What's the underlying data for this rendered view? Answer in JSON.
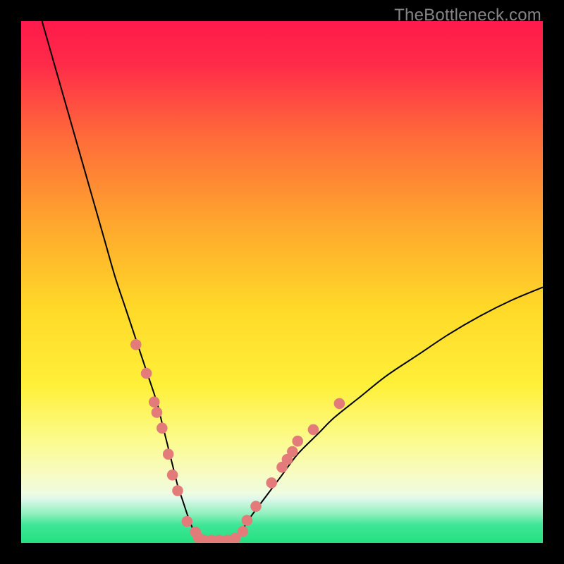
{
  "watermark": "TheBottleneck.com",
  "chart_data": {
    "type": "line",
    "title": "",
    "xlabel": "",
    "ylabel": "",
    "xlim": [
      0,
      100
    ],
    "ylim": [
      0,
      100
    ],
    "gradient_stops": [
      {
        "offset": 0.0,
        "color": "#ff1a4b"
      },
      {
        "offset": 0.08,
        "color": "#ff2a49"
      },
      {
        "offset": 0.22,
        "color": "#ff6a3a"
      },
      {
        "offset": 0.38,
        "color": "#ffa42e"
      },
      {
        "offset": 0.55,
        "color": "#ffd928"
      },
      {
        "offset": 0.7,
        "color": "#fff03a"
      },
      {
        "offset": 0.8,
        "color": "#fcfb8a"
      },
      {
        "offset": 0.87,
        "color": "#f7fbc4"
      },
      {
        "offset": 0.905,
        "color": "#eefce0"
      },
      {
        "offset": 0.915,
        "color": "#dff8ea"
      },
      {
        "offset": 0.945,
        "color": "#8ef0bb"
      },
      {
        "offset": 0.965,
        "color": "#3fe697"
      },
      {
        "offset": 1.0,
        "color": "#25e081"
      }
    ],
    "series": [
      {
        "name": "bottleneck-curve",
        "color": "#000000",
        "x": [
          4,
          6,
          8,
          10,
          12,
          14,
          16,
          18,
          20,
          22,
          24,
          26,
          27,
          28,
          29,
          30,
          31,
          32,
          33,
          34,
          35,
          36.5,
          38,
          40,
          42,
          44,
          47,
          50,
          53,
          57,
          60,
          65,
          70,
          76,
          82,
          88,
          94,
          100
        ],
        "y": [
          100,
          93,
          86,
          79,
          72,
          65,
          58,
          51,
          45,
          39,
          33,
          27,
          23,
          19,
          15,
          11,
          8,
          5,
          2.5,
          1,
          0,
          0,
          0,
          0.5,
          2,
          5,
          9,
          13,
          17,
          21,
          24,
          28,
          32,
          36,
          40,
          43.5,
          46.5,
          49
        ]
      }
    ],
    "scatter_points": {
      "color": "#e47b7b",
      "radius_plot_units": 1.05,
      "points": [
        {
          "x": 22.0,
          "y": 38.0
        },
        {
          "x": 24.0,
          "y": 32.5
        },
        {
          "x": 25.5,
          "y": 27.0
        },
        {
          "x": 26.0,
          "y": 25.0
        },
        {
          "x": 27.0,
          "y": 22.0
        },
        {
          "x": 28.2,
          "y": 17.0
        },
        {
          "x": 29.0,
          "y": 13.0
        },
        {
          "x": 30.0,
          "y": 10.0
        },
        {
          "x": 31.8,
          "y": 4.1
        },
        {
          "x": 33.4,
          "y": 2.1
        },
        {
          "x": 34.0,
          "y": 1.0
        },
        {
          "x": 35.0,
          "y": 0.5
        },
        {
          "x": 36.5,
          "y": 0.5
        },
        {
          "x": 38.0,
          "y": 0.5
        },
        {
          "x": 39.5,
          "y": 0.5
        },
        {
          "x": 41.0,
          "y": 0.9
        },
        {
          "x": 42.5,
          "y": 2.2
        },
        {
          "x": 43.3,
          "y": 4.3
        },
        {
          "x": 45.0,
          "y": 7.0
        },
        {
          "x": 48.0,
          "y": 11.5
        },
        {
          "x": 50.0,
          "y": 14.5
        },
        {
          "x": 51.0,
          "y": 16.0
        },
        {
          "x": 52.0,
          "y": 17.5
        },
        {
          "x": 53.0,
          "y": 19.5
        },
        {
          "x": 56.0,
          "y": 21.7
        },
        {
          "x": 61.0,
          "y": 26.7
        }
      ]
    }
  }
}
